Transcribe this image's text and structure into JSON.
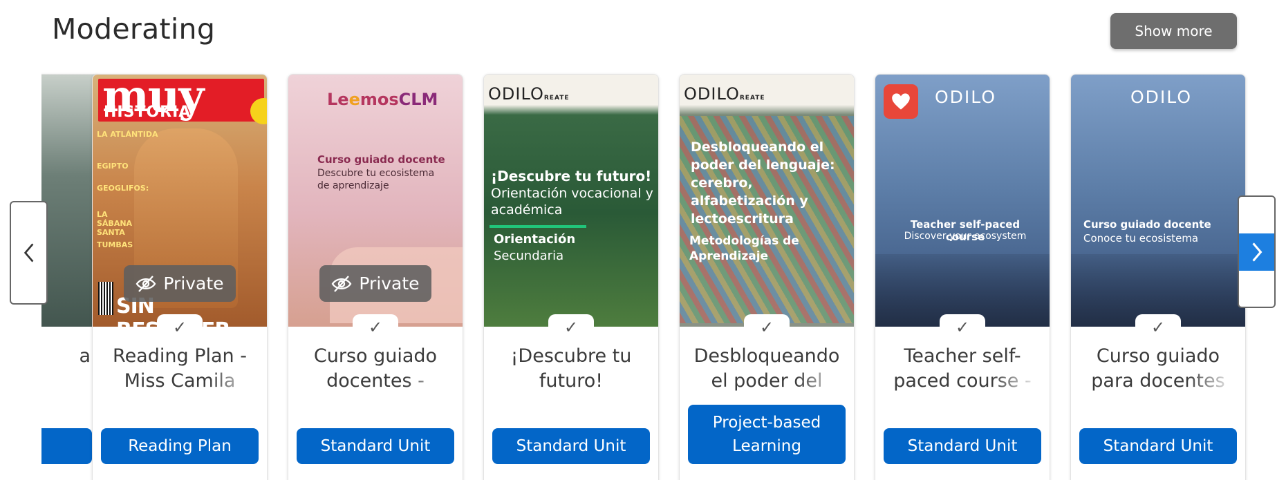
{
  "section": {
    "title": "Moderating"
  },
  "show_more": {
    "label": "Show more"
  },
  "partial_card": {
    "title": "a"
  },
  "cards": [
    {
      "cover_lines": [
        "muy",
        "HISTORIA",
        "LA ATLÁNTIDA",
        "EGIPTO",
        "GEOGLIFOS:",
        "LA SÁBANA SANTA",
        "TUMBAS",
        "SIN RESOLVER"
      ],
      "private": "Private",
      "title": "Reading Plan - Miss Camila",
      "type": "Reading Plan"
    },
    {
      "cover_lines": [
        "Le",
        "mos",
        "CLM",
        "Curso guiado docente",
        "Descubre tu ecosistema de aprendizaje"
      ],
      "private": "Private",
      "title": "Curso guiado docentes -",
      "type": "Standard Unit"
    },
    {
      "cover_lines": [
        "ODILO",
        "REATE",
        "¡Descubre tu futuro!",
        "Orientación vocacional y académica",
        "Orientación",
        "Secundaria"
      ],
      "title": "¡Descubre tu futuro!",
      "type": "Standard Unit"
    },
    {
      "cover_lines": [
        "ODILO",
        "REATE",
        "Desbloqueando el poder del lenguaje: cerebro, alfabetización y lectoescritura",
        "Metodologías de Aprendizaje"
      ],
      "title": "Desbloqueando el poder del",
      "type": "Project-based Learning"
    },
    {
      "cover_lines": [
        "ODILO",
        "Teacher self-paced course",
        "Discover your ecosystem"
      ],
      "title": "Teacher self-paced course -",
      "type": "Standard Unit"
    },
    {
      "cover_lines": [
        "ODILO",
        "Curso guiado docente",
        "Conoce tu ecosistema"
      ],
      "title": "Curso guiado para docentes",
      "type": "Standard Unit"
    }
  ],
  "colors": {
    "primary": "#0366c8",
    "arrow_active": "#1d7fe0",
    "favorite": "#e8473a",
    "muy_red": "#e31d26"
  },
  "icons": {
    "check": "check-icon",
    "private": "eye-slash-icon",
    "favorite": "heart-icon",
    "prev": "chevron-left-icon",
    "next": "chevron-right-icon"
  }
}
